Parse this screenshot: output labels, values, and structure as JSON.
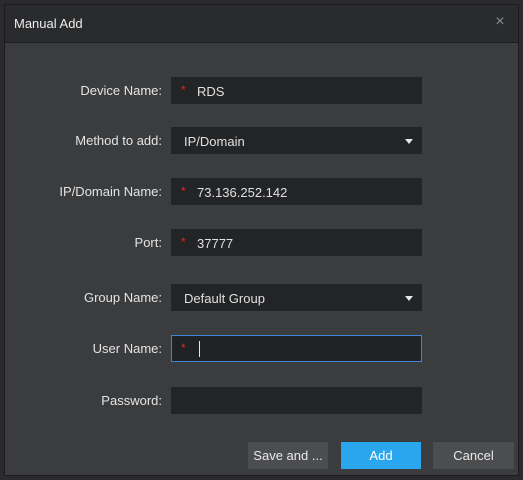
{
  "dialog": {
    "title": "Manual Add",
    "close_glyph": "×"
  },
  "form": {
    "device_name": {
      "label": "Device Name:",
      "value": "RDS",
      "required_mark": "*"
    },
    "method": {
      "label": "Method to add:",
      "value": "IP/Domain"
    },
    "ip_domain": {
      "label": "IP/Domain Name:",
      "value": "73.136.252.142",
      "required_mark": "*"
    },
    "port": {
      "label": "Port:",
      "value": "37777",
      "required_mark": "*"
    },
    "group": {
      "label": "Group Name:",
      "value": "Default Group"
    },
    "user_name": {
      "label": "User Name:",
      "value": "",
      "required_mark": "*"
    },
    "password": {
      "label": "Password:",
      "value": ""
    }
  },
  "buttons": {
    "save_and": "Save and ...",
    "add": "Add",
    "cancel": "Cancel"
  },
  "colors": {
    "accent": "#2aa6ef",
    "required": "#e0262a",
    "focus_border": "#3f87d6"
  }
}
